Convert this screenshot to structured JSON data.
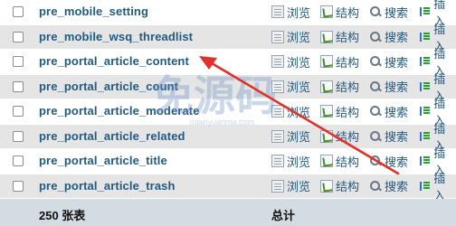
{
  "tables": [
    {
      "name": "pre_mobile_setting"
    },
    {
      "name": "pre_mobile_wsq_threadlist"
    },
    {
      "name": "pre_portal_article_content"
    },
    {
      "name": "pre_portal_article_count"
    },
    {
      "name": "pre_portal_article_moderate"
    },
    {
      "name": "pre_portal_article_related"
    },
    {
      "name": "pre_portal_article_title"
    },
    {
      "name": "pre_portal_article_trash"
    }
  ],
  "actions": {
    "browse": "浏览",
    "structure": "结构",
    "search": "搜索",
    "insert": "插入"
  },
  "footer": {
    "count": "250 张表",
    "total": "总计"
  },
  "watermark": {
    "text": "免源码",
    "sub": "mianyuanma.com"
  },
  "colors": {
    "link": "#235a81",
    "arrow": "#e0312b",
    "row_alt": "#e5e5e5"
  }
}
